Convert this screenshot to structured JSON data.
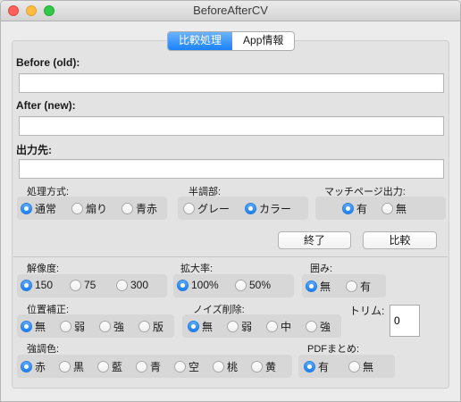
{
  "window": {
    "title": "BeforeAfterCV"
  },
  "tabs": [
    {
      "label": "比較処理",
      "active": true
    },
    {
      "label": "App情報",
      "active": false
    }
  ],
  "fields": {
    "before_label": "Before (old):",
    "before_value": "",
    "after_label": "After (new):",
    "after_value": "",
    "output_label": "出力先:",
    "output_value": ""
  },
  "groups": {
    "processing": {
      "label": "処理方式:",
      "options": [
        "通常",
        "煽り",
        "青赤"
      ],
      "selected": "通常"
    },
    "halftone": {
      "label": "半調部:",
      "options": [
        "グレー",
        "カラー"
      ],
      "selected": "カラー"
    },
    "match_page": {
      "label": "マッチページ出力:",
      "options": [
        "有",
        "無"
      ],
      "selected": "有"
    },
    "resolution": {
      "label": "解像度:",
      "options": [
        "150",
        "75",
        "300"
      ],
      "selected": "150"
    },
    "zoom": {
      "label": "拡大率:",
      "options": [
        "100%",
        "50%"
      ],
      "selected": "100%"
    },
    "frame": {
      "label": "囲み:",
      "options": [
        "無",
        "有"
      ],
      "selected": "無"
    },
    "position": {
      "label": "位置補正:",
      "options": [
        "無",
        "弱",
        "強",
        "版"
      ],
      "selected": "無"
    },
    "noise": {
      "label": "ノイズ削除:",
      "options": [
        "無",
        "弱",
        "中",
        "強"
      ],
      "selected": "無"
    },
    "highlight": {
      "label": "強調色:",
      "options": [
        "赤",
        "黒",
        "藍",
        "青",
        "空",
        "桃",
        "黄"
      ],
      "selected": "赤"
    },
    "pdf_merge": {
      "label": "PDFまとめ:",
      "options": [
        "有",
        "無"
      ],
      "selected": "有"
    }
  },
  "trim": {
    "label": "トリム:",
    "value": "0"
  },
  "buttons": {
    "finish": "終了",
    "compare": "比較"
  },
  "colors": {
    "accent": "#1a82fb",
    "close": "#fc615d",
    "minimize": "#fdbc40",
    "maximize": "#34c84a"
  }
}
